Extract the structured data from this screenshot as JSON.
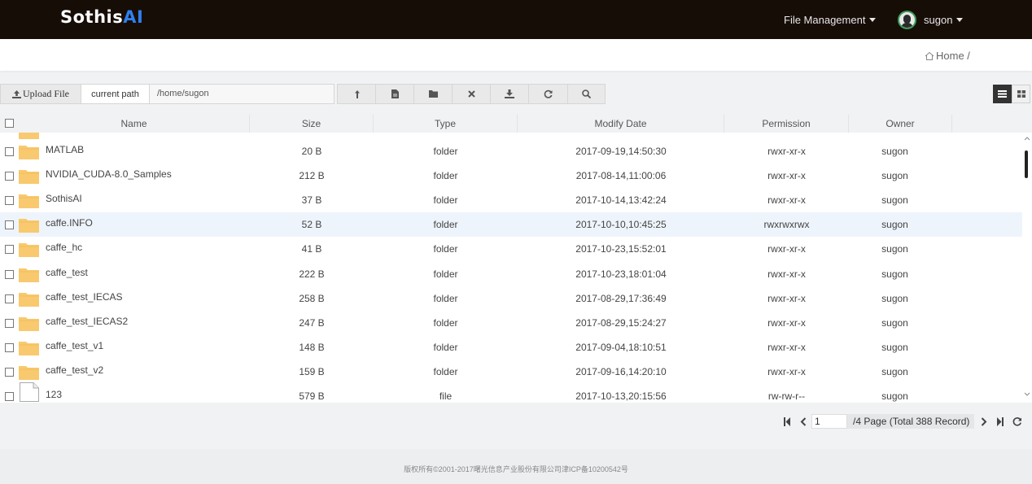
{
  "header": {
    "logo_main": "Sothis",
    "logo_accent": "AI",
    "file_menu": "File Management",
    "user": "sugon"
  },
  "breadcrumb": {
    "home": "Home /"
  },
  "toolbar": {
    "upload_label": "Upload File",
    "path_label": "current path",
    "path_value": "/home/sugon",
    "icons": [
      "up-directory-icon",
      "new-file-icon",
      "new-folder-icon",
      "delete-icon",
      "download-icon",
      "refresh-icon",
      "search-icon"
    ]
  },
  "table": {
    "columns": [
      "Name",
      "Size",
      "Type",
      "Modify Date",
      "Permission",
      "Owner"
    ],
    "rows": [
      {
        "name": "MATLAB",
        "size": "20 B",
        "type": "folder",
        "date": "2017-09-19,14:50:30",
        "perm": "rwxr-xr-x",
        "owner": "sugon"
      },
      {
        "name": "NVIDIA_CUDA-8.0_Samples",
        "size": "212 B",
        "type": "folder",
        "date": "2017-08-14,11:00:06",
        "perm": "rwxr-xr-x",
        "owner": "sugon"
      },
      {
        "name": "SothisAI",
        "size": "37 B",
        "type": "folder",
        "date": "2017-10-14,13:42:24",
        "perm": "rwxr-xr-x",
        "owner": "sugon"
      },
      {
        "name": "caffe.INFO",
        "size": "52 B",
        "type": "folder",
        "date": "2017-10-10,10:45:25",
        "perm": "rwxrwxrwx",
        "owner": "sugon"
      },
      {
        "name": "caffe_hc",
        "size": "41 B",
        "type": "folder",
        "date": "2017-10-23,15:52:01",
        "perm": "rwxr-xr-x",
        "owner": "sugon"
      },
      {
        "name": "caffe_test",
        "size": "222 B",
        "type": "folder",
        "date": "2017-10-23,18:01:04",
        "perm": "rwxr-xr-x",
        "owner": "sugon"
      },
      {
        "name": "caffe_test_IECAS",
        "size": "258 B",
        "type": "folder",
        "date": "2017-08-29,17:36:49",
        "perm": "rwxr-xr-x",
        "owner": "sugon"
      },
      {
        "name": "caffe_test_IECAS2",
        "size": "247 B",
        "type": "folder",
        "date": "2017-08-29,15:24:27",
        "perm": "rwxr-xr-x",
        "owner": "sugon"
      },
      {
        "name": "caffe_test_v1",
        "size": "148 B",
        "type": "folder",
        "date": "2017-09-04,18:10:51",
        "perm": "rwxr-xr-x",
        "owner": "sugon"
      },
      {
        "name": "caffe_test_v2",
        "size": "159 B",
        "type": "folder",
        "date": "2017-09-16,14:20:10",
        "perm": "rwxr-xr-x",
        "owner": "sugon"
      },
      {
        "name": "123",
        "size": "579 B",
        "type": "file",
        "date": "2017-10-13,20:15:56",
        "perm": "rw-rw-r--",
        "owner": "sugon"
      }
    ]
  },
  "pager": {
    "page": "1",
    "info": "/4 Page (Total 388 Record)"
  },
  "footer": "版权所有©2001-2017曙光信息产业股份有限公司津ICP备10200542号",
  "colors": {
    "topbar": "#170d07",
    "accent": "#2f80ed",
    "folder": "#f8c96e"
  }
}
